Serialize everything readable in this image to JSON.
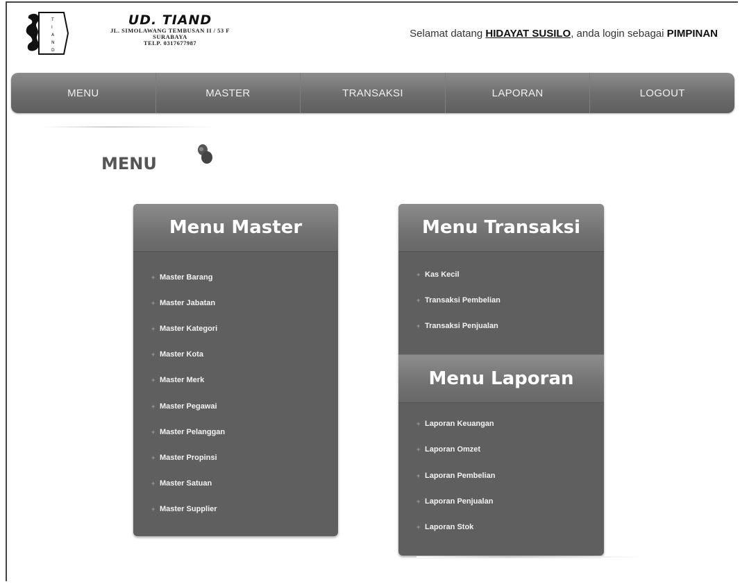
{
  "header": {
    "company_name": "UD. TIAND",
    "address": "JL. SIMOLAWANG TEMBUSAN II / 53 F",
    "city": "SURABAYA",
    "phone": "TELP. 0317677987",
    "welcome_prefix": "Selamat datang ",
    "user_name": "HIDAYAT SUSILO",
    "welcome_middle": ", anda login sebagai ",
    "role": "PIMPINAN"
  },
  "nav": {
    "items": [
      "MENU",
      "MASTER",
      "TRANSAKSI",
      "LAPORAN",
      "LOGOUT"
    ]
  },
  "page": {
    "title": "MENU"
  },
  "menu_master": {
    "title": "Menu Master",
    "items": [
      "Master Barang",
      "Master Jabatan",
      "Master Kategori",
      "Master Kota",
      "Master Merk",
      "Master Pegawai",
      "Master Pelanggan",
      "Master Propinsi",
      "Master Satuan",
      "Master Supplier"
    ]
  },
  "menu_transaksi": {
    "title": "Menu Transaksi",
    "items": [
      "Kas Kecil",
      "Transaksi Pembelian",
      "Transaksi Penjualan"
    ]
  },
  "menu_laporan": {
    "title": "Menu Laporan",
    "items": [
      "Laporan Keuangan",
      "Laporan Omzet",
      "Laporan Pembelian",
      "Laporan Penjualan",
      "Laporan Stok"
    ]
  },
  "colors": {
    "panel_bg": "#5f5f5f",
    "navbar_bg": "#6d6d6d"
  },
  "icons": {
    "logo": "company-logo-icon",
    "title_ornament": "ornament-icon",
    "bullet": "plus"
  }
}
